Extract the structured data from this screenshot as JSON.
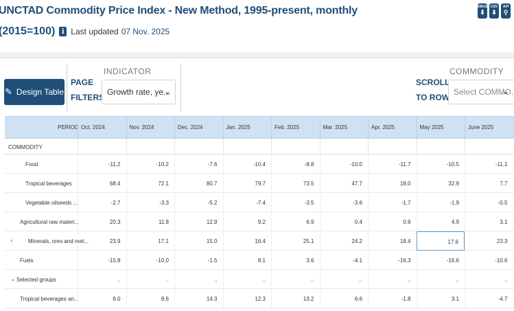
{
  "header": {
    "title_line1": "UNCTAD Commodity Price Index - New Method, 1995-present, monthly",
    "title_unit": "(2015=100)",
    "info_icon_label": "i",
    "last_updated_label": "Last updated",
    "last_updated_value": "07 Nov. 2025",
    "downloads": [
      {
        "label": "DBUS",
        "icon": "download-icon"
      },
      {
        "label": "CSV",
        "icon": "download-icon"
      },
      {
        "label": "API",
        "icon": "api-icon"
      }
    ]
  },
  "toolbar": {
    "design_table_label": "Design Table",
    "page_filters_line1": "PAGE",
    "page_filters_line2": "FILTERS",
    "indicator_label": "INDICATOR",
    "indicator_value": "Growth rate, ye...",
    "scroll_line1": "SCROLL",
    "scroll_line2": "TO ROW",
    "commodity_label": "COMMODITY",
    "commodity_placeholder": "Select COMMO..."
  },
  "table": {
    "period_label": "PERIOD",
    "commodity_label": "COMMODITY",
    "periods": [
      "Oct. 2024",
      "Nov. 2024",
      "Dec. 2024",
      "Jan. 2025",
      "Feb. 2025",
      "Mar. 2025",
      "Apr. 2025",
      "May 2025",
      "June 2025"
    ],
    "rows": [
      {
        "name": "Food",
        "toggle": "",
        "values": [
          "-11.2",
          "-10.2",
          "-7.6",
          "-10.4",
          "-8.8",
          "-10.0",
          "-11.7",
          "-10.5",
          "-11.1"
        ]
      },
      {
        "name": "Tropical beverages",
        "toggle": "",
        "values": [
          "68.4",
          "72.1",
          "80.7",
          "79.7",
          "73.5",
          "47.7",
          "18.0",
          "32.9",
          "7.7"
        ]
      },
      {
        "name": "Vegetable oilseeds ...",
        "toggle": "",
        "values": [
          "-2.7",
          "-3.3",
          "-5.2",
          "-7.4",
          "-3.5",
          "-3.6",
          "-1.7",
          "-1.9",
          "-0.5"
        ]
      },
      {
        "name": "Agricultural raw materi...",
        "toggle": "",
        "values": [
          "20.3",
          "11.8",
          "12.9",
          "9.2",
          "6.9",
          "0.4",
          "0.9",
          "4.9",
          "3.1"
        ]
      },
      {
        "name": "Minerals, ores and met...",
        "toggle": "›",
        "values": [
          "23.9",
          "17.1",
          "15.0",
          "16.4",
          "25.1",
          "24.2",
          "18.4",
          "17.6",
          "23.3"
        ]
      },
      {
        "name": "Fuels",
        "toggle": "",
        "values": [
          "-15.8",
          "-10.0",
          "-1.5",
          "8.1",
          "3.6",
          "-4.1",
          "-16.3",
          "-16.6",
          "-10.6"
        ]
      },
      {
        "name": "Selected groups",
        "toggle": "⌄",
        "values": [
          "..",
          "..",
          "..",
          "..",
          "..",
          "..",
          "..",
          "..",
          ".."
        ]
      },
      {
        "name": "Tropical beverages an...",
        "toggle": "",
        "values": [
          "6.0",
          "8.6",
          "14.3",
          "12.3",
          "13.2",
          "6.6",
          "-1.8",
          "3.1",
          "-4.7"
        ]
      }
    ]
  }
}
